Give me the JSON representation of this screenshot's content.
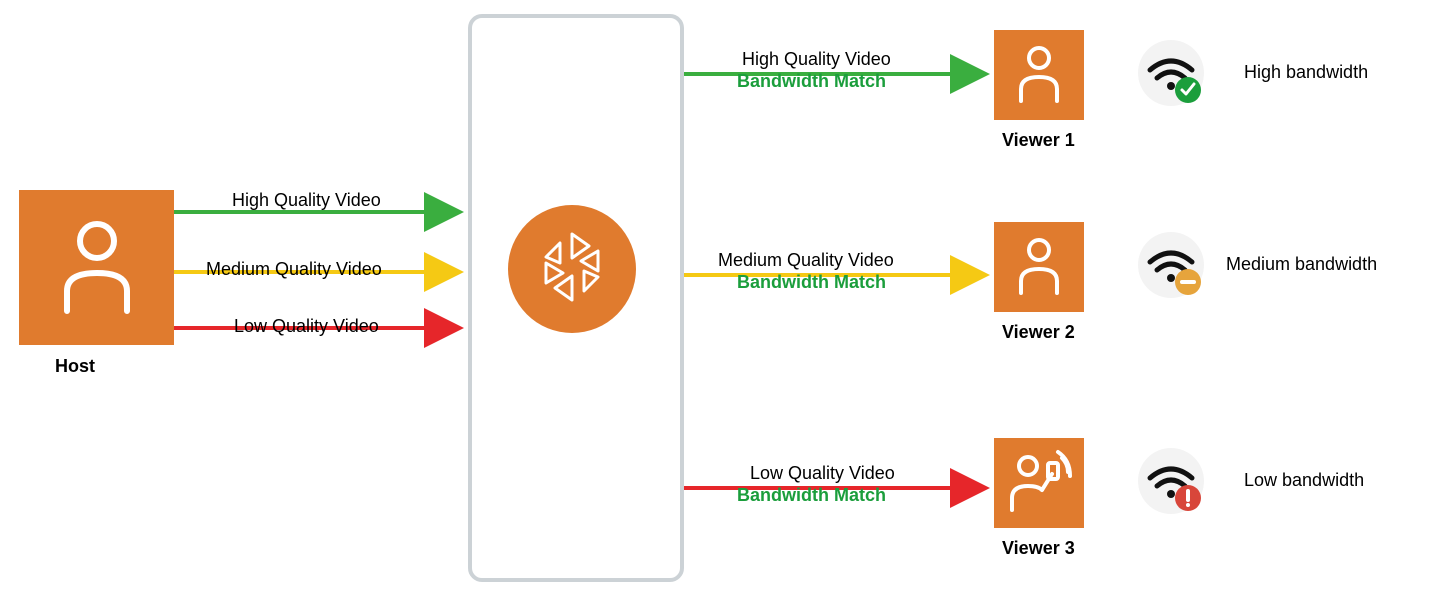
{
  "host": {
    "label": "Host"
  },
  "server": {
    "name": "streaming-server"
  },
  "host_streams": {
    "high": "High Quality Video",
    "medium": "Medium Quality Video",
    "low": "Low Quality Video"
  },
  "viewer_streams": {
    "high": {
      "quality": "High Quality Video",
      "match": "Bandwidth Match"
    },
    "medium": {
      "quality": "Medium Quality Video",
      "match": "Bandwidth Match"
    },
    "low": {
      "quality": "Low Quality Video",
      "match": "Bandwidth Match"
    }
  },
  "viewers": {
    "v1": {
      "label": "Viewer 1",
      "bandwidth": "High bandwidth",
      "status": "ok"
    },
    "v2": {
      "label": "Viewer 2",
      "bandwidth": "Medium bandwidth",
      "status": "med"
    },
    "v3": {
      "label": "Viewer 3",
      "bandwidth": "Low bandwidth",
      "status": "low"
    }
  },
  "colors": {
    "orange": "#e07b2e",
    "green": "#3aae3f",
    "yellow": "#f5c914",
    "red": "#e6262a",
    "match_green": "#1b9e3c",
    "ok_badge": "#1b9e3c",
    "med_badge": "#e6a43c",
    "low_badge": "#d8463a"
  }
}
